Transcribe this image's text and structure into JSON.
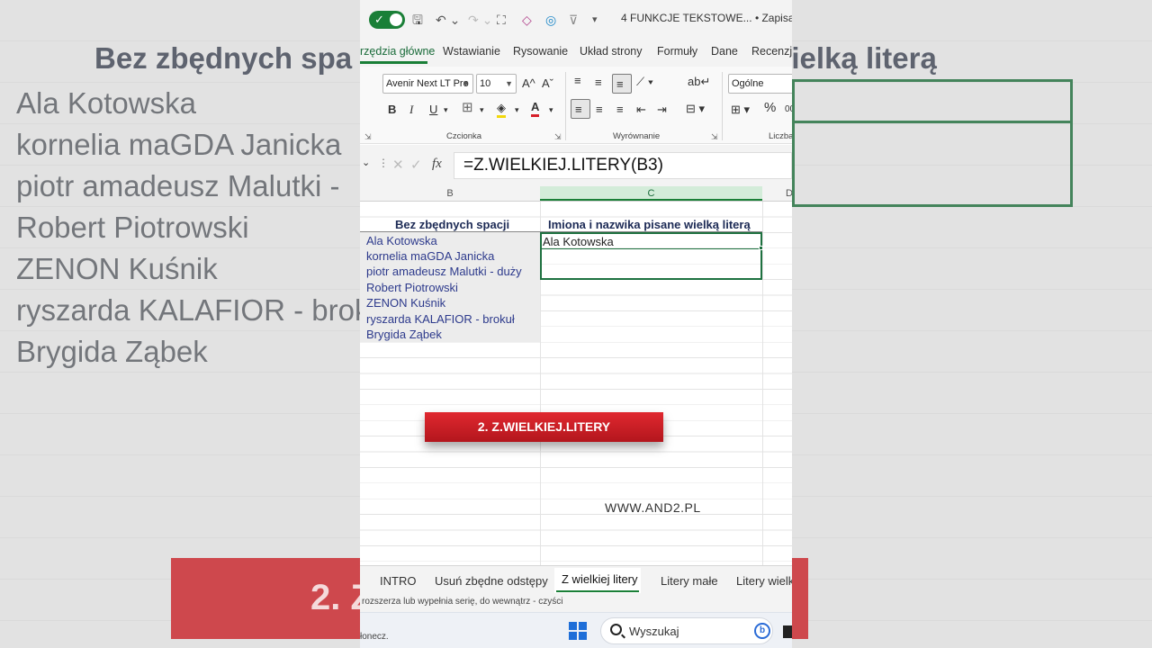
{
  "background": {
    "title_left": "Bez zbędnych spa",
    "title_right": "pisane wielką literą",
    "names": [
      "Ala Kotowska",
      "kornelia maGDA Janicka",
      "piotr amadeusz Malutki -",
      "Robert Piotrowski",
      "ZENON Kuśnik",
      "ryszarda KALAFIOR - brok",
      "Brygida Ząbek"
    ],
    "banner_text": "2. Z"
  },
  "qat": {
    "save_icon": "save-icon",
    "undo_icon": "undo-icon",
    "redo_icon": "redo-icon",
    "document_title": "4 FUNKCJE TEKSTOWE...",
    "save_status": "• Zapisano",
    "title_chevron": "⌄"
  },
  "ribbon_tabs": {
    "items": [
      "rzędzia główne",
      "Wstawianie",
      "Rysowanie",
      "Układ strony",
      "Formuły",
      "Dane",
      "Recenzja"
    ],
    "active": "rzędzia główne"
  },
  "ribbon": {
    "font_name": "Avenir Next LT Pro",
    "font_size": "10",
    "number_format": "Ogólne",
    "group_font": "Czcionka",
    "group_alignment": "Wyrównanie",
    "group_number": "Liczba",
    "bold": "B",
    "italic": "I",
    "underline": "U",
    "grow_font": "A^",
    "shrink_font": "Aˇ",
    "percent": "%",
    "decimals": "00"
  },
  "formula_bar": {
    "formula": "=Z.WIELKIEJ.LITERY(B3)",
    "fx": "fx"
  },
  "columns": {
    "b": "B",
    "c": "C",
    "d": "D"
  },
  "sheet": {
    "header_b": "Bez zbędnych spacji",
    "header_c": "Imiona i nazwika pisane wielką literą",
    "names": [
      "Ala Kotowska",
      "kornelia maGDA Janicka",
      "piotr amadeusz Malutki - duży",
      "Robert Piotrowski",
      "ZENON Kuśnik",
      "ryszarda KALAFIOR - brokuł",
      "Brygida Ząbek"
    ],
    "result_c3": "Ala Kotowska",
    "banner": "2. Z.WIELKIEJ.LITERY",
    "website": "WWW.AND2.PL"
  },
  "sheet_tabs": {
    "items": [
      "INTRO",
      "Usuń zbędne odstępy",
      "Z wielkiej litery",
      "Litery małe",
      "Litery wielk"
    ],
    "active": "Z wielkiej litery"
  },
  "status_bar": {
    "text": "rozszerza lub wypełnia serię, do wewnątrz - czyści"
  },
  "taskbar": {
    "hint": "łonecz.",
    "search_placeholder": "Wyszukaj"
  },
  "colors": {
    "accent_green": "#1a7f37",
    "banner_red": "#d4212a",
    "name_text": "#2d3a8c"
  }
}
